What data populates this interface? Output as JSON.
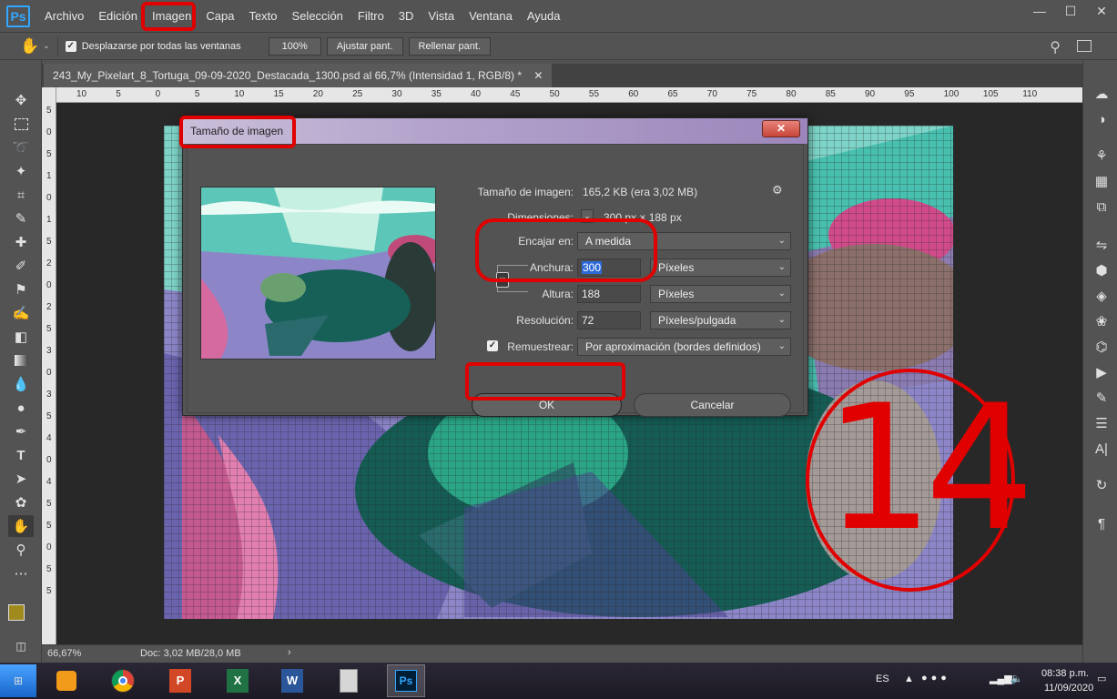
{
  "app": {
    "logo": "Ps"
  },
  "menu": [
    "Archivo",
    "Edición",
    "Imagen",
    "Capa",
    "Texto",
    "Selección",
    "Filtro",
    "3D",
    "Vista",
    "Ventana",
    "Ayuda"
  ],
  "options": {
    "scroll_all": "Desplazarse por todas las ventanas",
    "zoom_100": "100%",
    "fit": "Ajustar pant.",
    "fill": "Rellenar pant."
  },
  "document": {
    "tab": "243_My_Pixelart_8_Tortuga_09-09-2020_Destacada_1300.psd al 66,7% (Intensidad 1, RGB/8) *",
    "ruler_labels": [
      "10",
      "5",
      "0",
      "5",
      "10",
      "15",
      "20",
      "25",
      "30",
      "35",
      "40",
      "45",
      "50",
      "55",
      "60",
      "65",
      "70",
      "75",
      "80",
      "85",
      "90",
      "95",
      "100",
      "105",
      "110"
    ],
    "ruler_left_labels": [
      "5",
      "0",
      "5",
      "1",
      "0",
      "1",
      "5",
      "2",
      "0",
      "2",
      "5",
      "3",
      "0",
      "3",
      "5",
      "4",
      "0",
      "4",
      "5",
      "5",
      "0",
      "5",
      "5"
    ]
  },
  "status": {
    "zoom": "66,67%",
    "doc": "Doc: 3,02 MB/28,0 MB"
  },
  "dialog": {
    "title": "Tamaño de imagen",
    "close": "✕",
    "size_label": "Tamaño de imagen:",
    "size_value": "165,2 KB (era 3,02 MB)",
    "dims_label": "Dimensiones:",
    "dims_value": "300 px × 188 px",
    "fit_label": "Encajar en:",
    "fit_value": "A medida",
    "width_label": "Anchura:",
    "width_value": "300",
    "width_unit": "Píxeles",
    "height_label": "Altura:",
    "height_value": "188",
    "height_unit": "Píxeles",
    "res_label": "Resolución:",
    "res_value": "72",
    "res_unit": "Píxeles/pulgada",
    "resample_label": "Remuestrear:",
    "resample_value": "Por aproximación (bordes definidos)",
    "ok": "OK",
    "cancel": "Cancelar"
  },
  "taskbar": {
    "lang": "ES",
    "time": "08:38 p.m.",
    "date": "11/09/2020"
  },
  "annotation": {
    "step": "14"
  },
  "colors": {
    "ps_blue": "#31a8ff",
    "annotation_red": "#e10000",
    "fg_swatch": "#a08a1e"
  }
}
